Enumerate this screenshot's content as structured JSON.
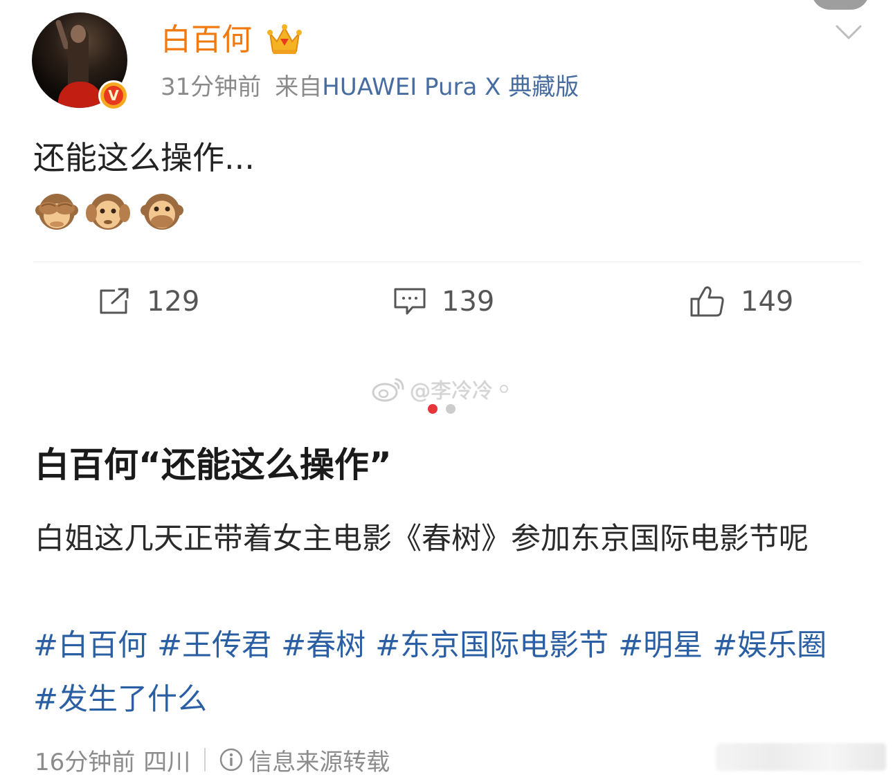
{
  "post": {
    "username": "白百何",
    "time_ago": "31分钟前",
    "from_label": "来自",
    "device": "HUAWEI Pura X 典藏版",
    "text": "还能这么操作...",
    "emojis": [
      "see-no-evil-monkey",
      "hear-no-evil-monkey",
      "speak-no-evil-monkey"
    ]
  },
  "actions": {
    "repost_count": "129",
    "comment_count": "139",
    "like_count": "149"
  },
  "watermark": {
    "text": "@李冷冷"
  },
  "carousel": {
    "active_index": 0,
    "total": 2,
    "active_color": "#e8343b",
    "inactive_color": "#cccccc"
  },
  "article": {
    "headline": "白百何“还能这么操作”",
    "body": "白姐这几天正带着女主电影《春树》参加东京国际电影节呢",
    "tags": [
      "#白百何",
      "#王传君",
      "#春树",
      "#东京国际电影节",
      "#明星",
      "#娱乐圈",
      "#发生了什么"
    ]
  },
  "footer": {
    "time_ago": "16分钟前",
    "region": "四川",
    "source_note": "信息来源转载"
  },
  "colors": {
    "username": "#f07a12",
    "device_link": "#476da0",
    "hashtag": "#2b5fa3",
    "verified_badge": "#f6a821"
  }
}
